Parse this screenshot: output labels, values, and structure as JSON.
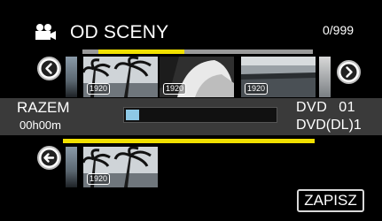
{
  "header": {
    "icon": "movie-camera-icon",
    "title": "OD SCENY",
    "counter": "0/999"
  },
  "navigation": {
    "prev_icon": "chevron-left-icon",
    "next_icon": "chevron-right-icon",
    "back_icon": "arrow-left-icon"
  },
  "scene_strip": {
    "position_indicator": 0.4,
    "thumbnails": [
      {
        "badge": "1920"
      },
      {
        "badge": "1920"
      },
      {
        "badge": "1920"
      },
      {
        "badge": "1920"
      },
      {
        "badge": ""
      }
    ]
  },
  "info": {
    "total_label": "RAZEM",
    "total_time": "00h00m",
    "capacity_used": 0.09,
    "disc_line1": "DVD 01",
    "disc_line2": "DVD(DL)1"
  },
  "selected": {
    "thumbnails": [
      {
        "badge": ""
      },
      {
        "badge": "1920"
      }
    ]
  },
  "actions": {
    "save_label": "ZAPISZ"
  },
  "colors": {
    "accent_yellow": "#f1e000",
    "band_gray": "#3a3a3a",
    "capacity_blue": "#8ec9e6"
  }
}
